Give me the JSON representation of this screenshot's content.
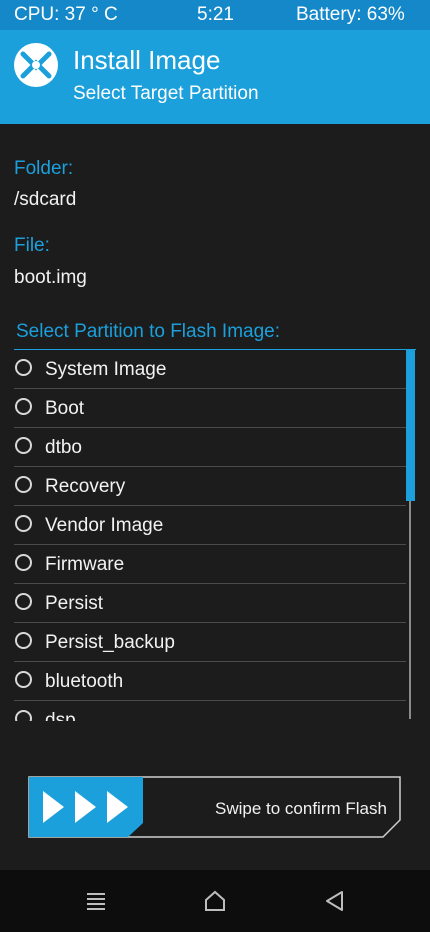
{
  "status_bar": {
    "cpu": "CPU: 37 °  C",
    "time": "5:21",
    "battery": "Battery: 63%"
  },
  "header": {
    "title": "Install Image",
    "subtitle": "Select Target Partition",
    "logo_icon": "twrp-logo-icon"
  },
  "folder": {
    "label": "Folder:",
    "value": "/sdcard"
  },
  "file": {
    "label": "File:",
    "value": "boot.img"
  },
  "partition_list": {
    "heading": "Select Partition to Flash Image:",
    "items": [
      "System Image",
      "Boot",
      "dtbo",
      "Recovery",
      "Vendor Image",
      "Firmware",
      "Persist",
      "Persist_backup",
      "bluetooth",
      "dsp"
    ]
  },
  "swipe": {
    "label": "Swipe to confirm Flash",
    "icon": "triple-arrow-right-icon"
  },
  "nav_bar": {
    "menu_icon": "menu-icon",
    "home_icon": "home-icon",
    "back_icon": "back-icon"
  },
  "colors": {
    "accent": "#1ba0dc",
    "status_bar": "#1488c8",
    "background": "#1c1c1c",
    "nav_bar": "#0d0d0d"
  }
}
